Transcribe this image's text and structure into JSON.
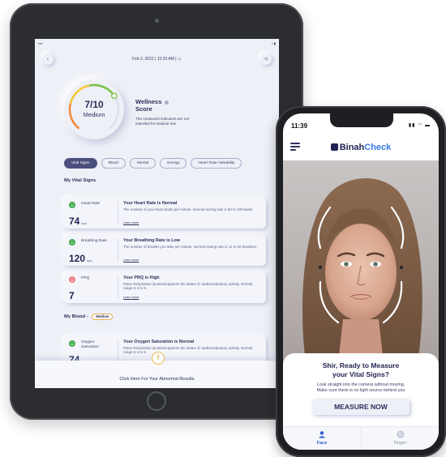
{
  "tablet": {
    "date_text": "Feb 2, 2022 | 10:30 AM |",
    "wellness": {
      "score": "7/10",
      "level": "Medium",
      "score_fraction": 0.7,
      "title": "Wellness",
      "title2": "Score",
      "note": "The measured indicators are not intended for medical use."
    },
    "tabs": [
      {
        "label": "Vital Signs",
        "active": true
      },
      {
        "label": "Blood",
        "active": false
      },
      {
        "label": "Mental",
        "active": false
      },
      {
        "label": "Energy",
        "active": false
      },
      {
        "label": "Heart Rate Variability",
        "active": false
      }
    ],
    "section_vitals": "My Vital Signs",
    "section_blood": "My Blood -",
    "section_blood_badge": "Medium",
    "vitals": [
      {
        "name": "Heart Rate",
        "value": "74",
        "unit": "bpm",
        "title": "Your Heart Rate is Normal",
        "desc": "The number of your heart beats per minute. Normal resting rate is 60 to 100 beats.",
        "learn": "Learn more",
        "status": "good"
      },
      {
        "name": "Breathing Rate",
        "value": "120",
        "unit": "bpm",
        "title": "Your Breathing Rate is Low",
        "desc": "The number of breaths you take per minute. Normal resting rate is 12 to 20 breathes.",
        "learn": "Learn more",
        "status": "good"
      },
      {
        "name": "PRQ",
        "value": "7",
        "unit": "",
        "title": "Your PRQ is High",
        "desc": "Pulse-Respiration Quotientcaptures the states of cardiorespiratory activity. Normal range is 4 to 5.",
        "learn": "Learn more",
        "status": "bad"
      },
      {
        "name": "Oxygen Saturation",
        "value": "74",
        "unit": "%",
        "title": "Your Oxygen Saturation is Normal",
        "desc": "Pulse-Respiration Quotientcaptures the states of cardiorespiratory activity. Normal range is 4 to 5.",
        "learn": "Learn more",
        "status": "good"
      }
    ],
    "abnormal_link": "Click Here For Your Abnormal Results"
  },
  "phone": {
    "time": "11:39",
    "brand_a": "Binah",
    "brand_b": "Check",
    "prompt_line1": "Shir, Ready to Measure",
    "prompt_line2": "your Vital Signs?",
    "instructions_1": "Look straight into the camera without moving.",
    "instructions_2": "Make sure there is no light source behind you",
    "measure_label": "MEASURE NOW",
    "tab_face": "Face",
    "tab_finger": "Finger"
  },
  "colors": {
    "good": "#3aa845",
    "bad": "#f07a7a",
    "accent": "#3979e6",
    "ring_start": "#f28b3c",
    "ring_mid": "#f6c63a",
    "ring_end": "#7cc14a"
  }
}
